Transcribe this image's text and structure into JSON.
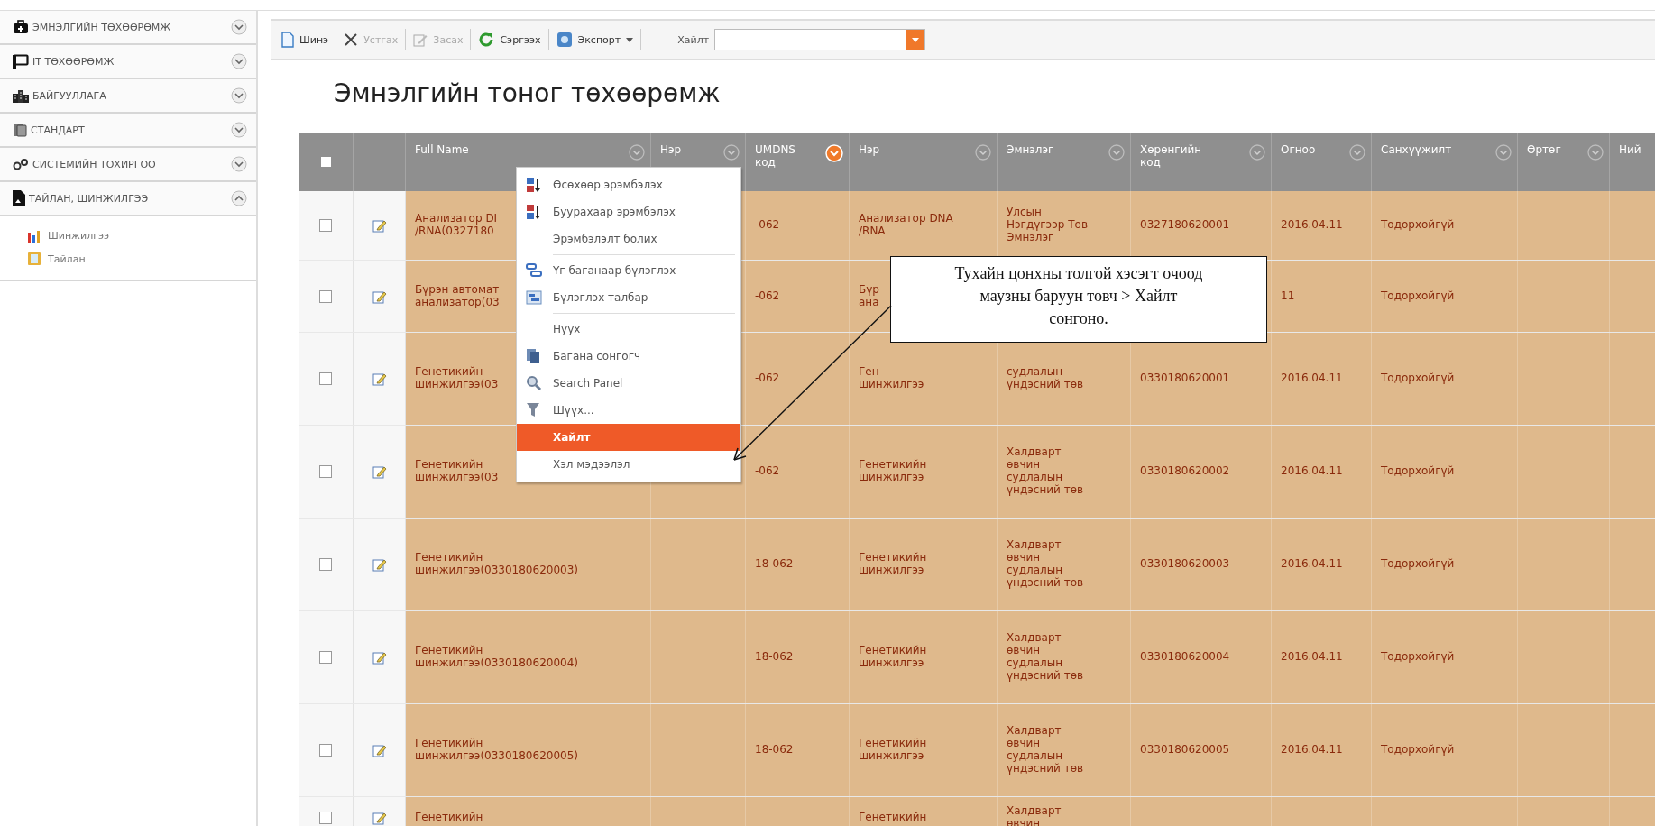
{
  "sidebar": {
    "items": [
      {
        "label": "ЭМНЭЛГИЙН ТӨХӨӨРӨМЖ",
        "expanded": false
      },
      {
        "label": "IT ТӨХӨӨРӨМЖ",
        "expanded": false
      },
      {
        "label": "БАЙГУУЛЛАГА",
        "expanded": false
      },
      {
        "label": "СТАНДАРТ",
        "expanded": false
      },
      {
        "label": "СИСТЕМИЙН ТОХИРГОО",
        "expanded": false
      },
      {
        "label": "ТАЙЛАН, ШИНЖИЛГЭЭ",
        "expanded": true,
        "children": [
          {
            "label": "Шинжилгээ"
          },
          {
            "label": "Тайлан"
          }
        ]
      }
    ]
  },
  "toolbar": {
    "buttons": [
      {
        "label": "Шинэ",
        "disabled": false,
        "dropdown": false
      },
      {
        "label": "Устгах",
        "disabled": true,
        "dropdown": false
      },
      {
        "label": "Засах",
        "disabled": true,
        "dropdown": false
      },
      {
        "label": "Сэргээх",
        "disabled": false,
        "dropdown": false
      },
      {
        "label": "Экспорт",
        "disabled": false,
        "dropdown": true
      }
    ],
    "search": {
      "label": "Хайлт"
    }
  },
  "page_title": "Эмнэлгийн тоног төхөөрөмж",
  "table": {
    "columns": [
      {
        "kind": "checkbox",
        "checked": false
      },
      {
        "kind": "blank"
      },
      {
        "kind": "text",
        "label": "Full Name",
        "active": false
      },
      {
        "kind": "text",
        "label": "Нэр",
        "active": false
      },
      {
        "kind": "text",
        "label": "UMDNS\nкод",
        "active": true
      },
      {
        "kind": "text",
        "label": "Нэр",
        "active": false
      },
      {
        "kind": "text",
        "label": "Эмнэлэг",
        "active": false
      },
      {
        "kind": "text",
        "label": "Хөрөнгийн\nкод",
        "active": false
      },
      {
        "kind": "text",
        "label": "Огноо",
        "active": false
      },
      {
        "kind": "text",
        "label": "Санхүүжилт",
        "active": false
      },
      {
        "kind": "text",
        "label": "Өртөг",
        "active": false
      },
      {
        "kind": "text",
        "label": "Ний"
      }
    ],
    "rows": [
      {
        "checked": false,
        "full_name": "Анализатор DI\n/RNA(0327180",
        "umdns_code": "-062",
        "name_2": "Анализатор DNA\n/RNA",
        "hospital": "Улсын\nНэгдүгээр Төв\nЭмнэлэг",
        "asset_code": "0327180620001",
        "date": "2016.04.11",
        "funding": "Тодорхойгүй"
      },
      {
        "checked": false,
        "full_name": "Бүрэн автомат\nанализатор(03",
        "umdns_code": "-062",
        "name_2": "Бүр\nана",
        "date": "11",
        "funding": "Тодорхойгүй"
      },
      {
        "checked": false,
        "full_name": "Генетикийн\nшинжилгээ(03",
        "umdns_code": "-062",
        "name_2": "Ген\nшинжилгээ",
        "hospital": "судлалын\nүндэсний төв",
        "asset_code": "0330180620001",
        "date": "2016.04.11",
        "funding": "Тодорхойгүй"
      },
      {
        "checked": false,
        "full_name": "Генетикийн\nшинжилгээ(03",
        "umdns_code": "-062",
        "name_2": "Генетикийн\nшинжилгээ",
        "hospital": "Халдварт\nөвчин\nсудлалын\nүндэсний төв",
        "asset_code": "0330180620002",
        "date": "2016.04.11",
        "funding": "Тодорхойгүй"
      },
      {
        "checked": false,
        "full_name": "Генетикийн\nшинжилгээ(0330180620003)",
        "umdns_code": "18-062",
        "name_2": "Генетикийн\nшинжилгээ",
        "hospital": "Халдварт\nөвчин\nсудлалын\nүндэсний төв",
        "asset_code": "0330180620003",
        "date": "2016.04.11",
        "funding": "Тодорхойгүй"
      },
      {
        "checked": false,
        "full_name": "Генетикийн\nшинжилгээ(0330180620004)",
        "umdns_code": "18-062",
        "name_2": "Генетикийн\nшинжилгээ",
        "hospital": "Халдварт\nөвчин\nсудлалын\nүндэсний төв",
        "asset_code": "0330180620004",
        "date": "2016.04.11",
        "funding": "Тодорхойгүй"
      },
      {
        "checked": false,
        "full_name": "Генетикийн\nшинжилгээ(0330180620005)",
        "umdns_code": "18-062",
        "name_2": "Генетикийн\nшинжилгээ",
        "hospital": "Халдварт\nөвчин\nсудлалын\nүндэсний төв",
        "asset_code": "0330180620005",
        "date": "2016.04.11",
        "funding": "Тодорхойгүй"
      },
      {
        "checked": false,
        "full_name": "Генетикийн",
        "name_2": "Генетикийн",
        "hospital": "Халдварт\nөвчин"
      }
    ]
  },
  "context_menu": {
    "items": [
      {
        "label": "Өсөхөөр эрэмбэлэх",
        "selected": false,
        "separator_before": false
      },
      {
        "label": "Буурахаар эрэмбэлэх",
        "selected": false,
        "separator_before": false
      },
      {
        "label": "Эрэмбэлэлт болих",
        "selected": false,
        "separator_before": false
      },
      {
        "label": "Үг баганаар бүлэглэх",
        "selected": false,
        "separator_before": true
      },
      {
        "label": "Бүлэглэх талбар",
        "selected": false,
        "separator_before": false
      },
      {
        "label": "Нуух",
        "selected": false,
        "separator_before": true
      },
      {
        "label": "Багана сонгогч",
        "selected": false,
        "separator_before": false
      },
      {
        "label": "Search Panel",
        "selected": false,
        "separator_before": false
      },
      {
        "label": "Шүүх...",
        "selected": false,
        "separator_before": false
      },
      {
        "label": "Хайлт",
        "selected": true,
        "separator_before": false
      },
      {
        "label": "Хэл мэдээлэл",
        "selected": false,
        "separator_before": false
      }
    ]
  },
  "callout": {
    "text": "Тухайн цонхны толгой хэсэгт очоод\nмаузны баруун товч > Хайлт\nсонгоно."
  }
}
